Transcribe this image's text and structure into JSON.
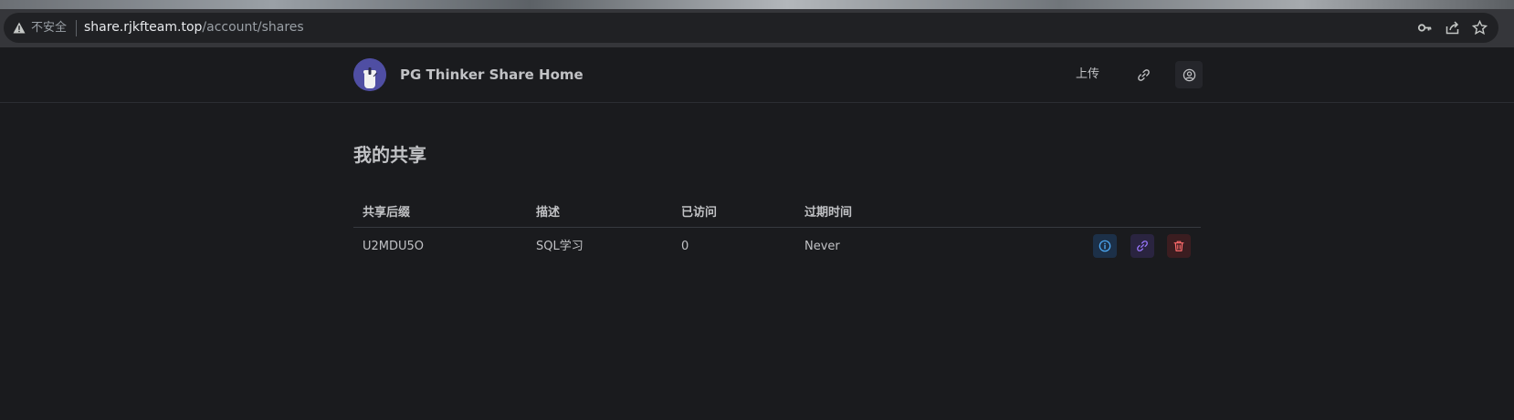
{
  "browser": {
    "security_label": "不安全",
    "url_host": "share.rjkfteam.top",
    "url_path": "/account/shares",
    "icons": [
      "warning-icon",
      "key-icon",
      "share-page-icon",
      "bookmark-star-icon"
    ]
  },
  "header": {
    "site_title": "PG Thinker Share Home",
    "upload_label": "上传",
    "icons": [
      "logo-icon",
      "link-icon",
      "user-icon"
    ]
  },
  "page": {
    "title": "我的共享"
  },
  "table": {
    "columns": [
      "共享后缀",
      "描述",
      "已访问",
      "过期时间"
    ],
    "rows": [
      {
        "suffix": "U2MDU5O",
        "description": "SQL学习",
        "visits": "0",
        "expires": "Never"
      }
    ],
    "row_actions": [
      "info-icon",
      "link-icon",
      "trash-icon"
    ]
  },
  "colors": {
    "background": "#1a1b1e",
    "text": "#c1c2c5",
    "info_accent": "#4dabf7",
    "link_accent": "#9775fa",
    "delete_accent": "#ff6b6b"
  }
}
